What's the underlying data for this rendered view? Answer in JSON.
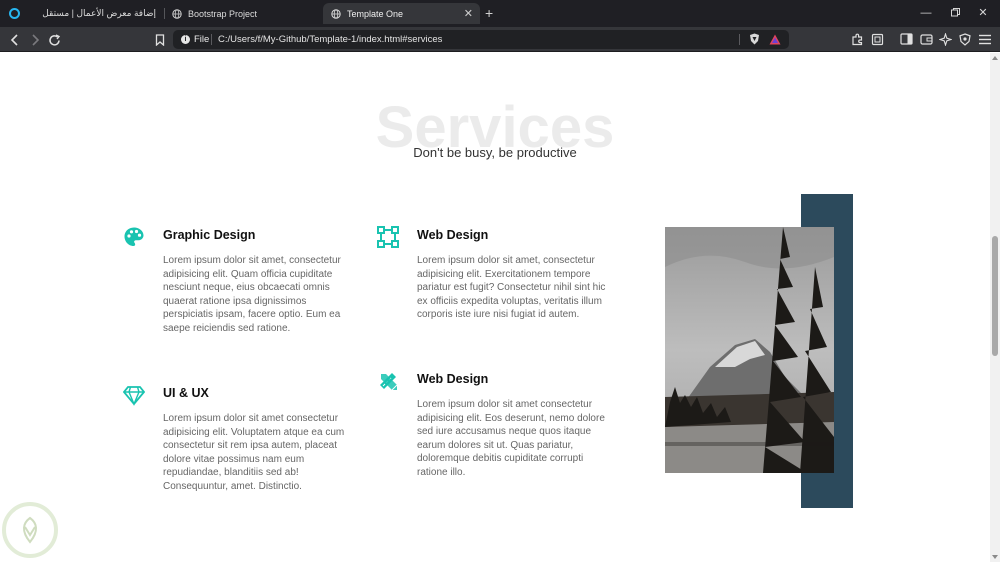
{
  "browser": {
    "tabs": [
      {
        "label": "إضافة معرض الأعمال | مستقل"
      },
      {
        "label": "Bootstrap Project"
      },
      {
        "label": "Template One"
      }
    ],
    "url_scheme": "File",
    "url": "C:/Users/f/My-Github/Template-1/index.html#services",
    "icons": {
      "app": "opera-logo-icon",
      "tab": "globe-icon",
      "close": "close-icon",
      "new_tab": "plus-icon",
      "back": "back-arrow-icon",
      "forward": "forward-arrow-icon",
      "reload": "reload-icon",
      "bookmark": "bookmark-icon",
      "info": "info-icon",
      "shield": "brave-shield-icon",
      "rewards": "brave-rewards-icon",
      "extensions": "extensions-icon",
      "screenshot": "screenshot-icon",
      "sidebar": "sidebar-icon",
      "wallet": "wallet-icon",
      "ai": "leo-ai-icon",
      "vpn": "vpn-icon",
      "menu": "hamburger-menu-icon",
      "minimize": "minimize-icon",
      "maximize": "restore-icon",
      "window_close": "window-close-icon"
    },
    "colors": {
      "titlebar": "#1f1f24",
      "toolbar": "#35363a",
      "urlbar": "#202124"
    }
  },
  "services_section": {
    "bg_title": "Services",
    "subtitle": "Don't be busy, be productive",
    "accent_color": "#19c3b0",
    "backdrop_color": "#2c4a5c",
    "items": [
      {
        "title": "Graphic Design",
        "icon": "palette-icon",
        "text": "Lorem ipsum dolor sit amet, consectetur adipisicing elit. Quam officia cupiditate nesciunt neque, eius obcaecati omnis quaerat ratione ipsa dignissimos perspiciatis ipsam, facere optio. Eum ea saepe reiciendis sed ratione."
      },
      {
        "title": "Web Design",
        "icon": "vector-square-icon",
        "text": "Lorem ipsum dolor sit amet, consectetur adipisicing elit. Exercitationem tempore pariatur est fugit? Consectetur nihil sint hic ex officiis expedita voluptas, veritatis illum corporis iste iure nisi fugiat id autem."
      },
      {
        "title": "UI & UX",
        "icon": "diamond-icon",
        "text": "Lorem ipsum dolor sit amet consectetur adipisicing elit. Voluptatem atque ea cum consectetur sit rem ipsa autem, placeat dolore vitae possimus nam eum repudiandae, blanditiis sed ab! Consequuntur, amet. Distinctio."
      },
      {
        "title": "Web Design",
        "icon": "pencil-ruler-icon",
        "text": "Lorem ipsum dolor sit amet consectetur adipisicing elit. Eos deserunt, nemo dolore sed iure accusamus neque quos itaque earum dolores sit ut. Quas pariatur, doloremque debitis cupiditate corrupti ratione illo."
      }
    ],
    "image": "mountain-forest-photo"
  }
}
